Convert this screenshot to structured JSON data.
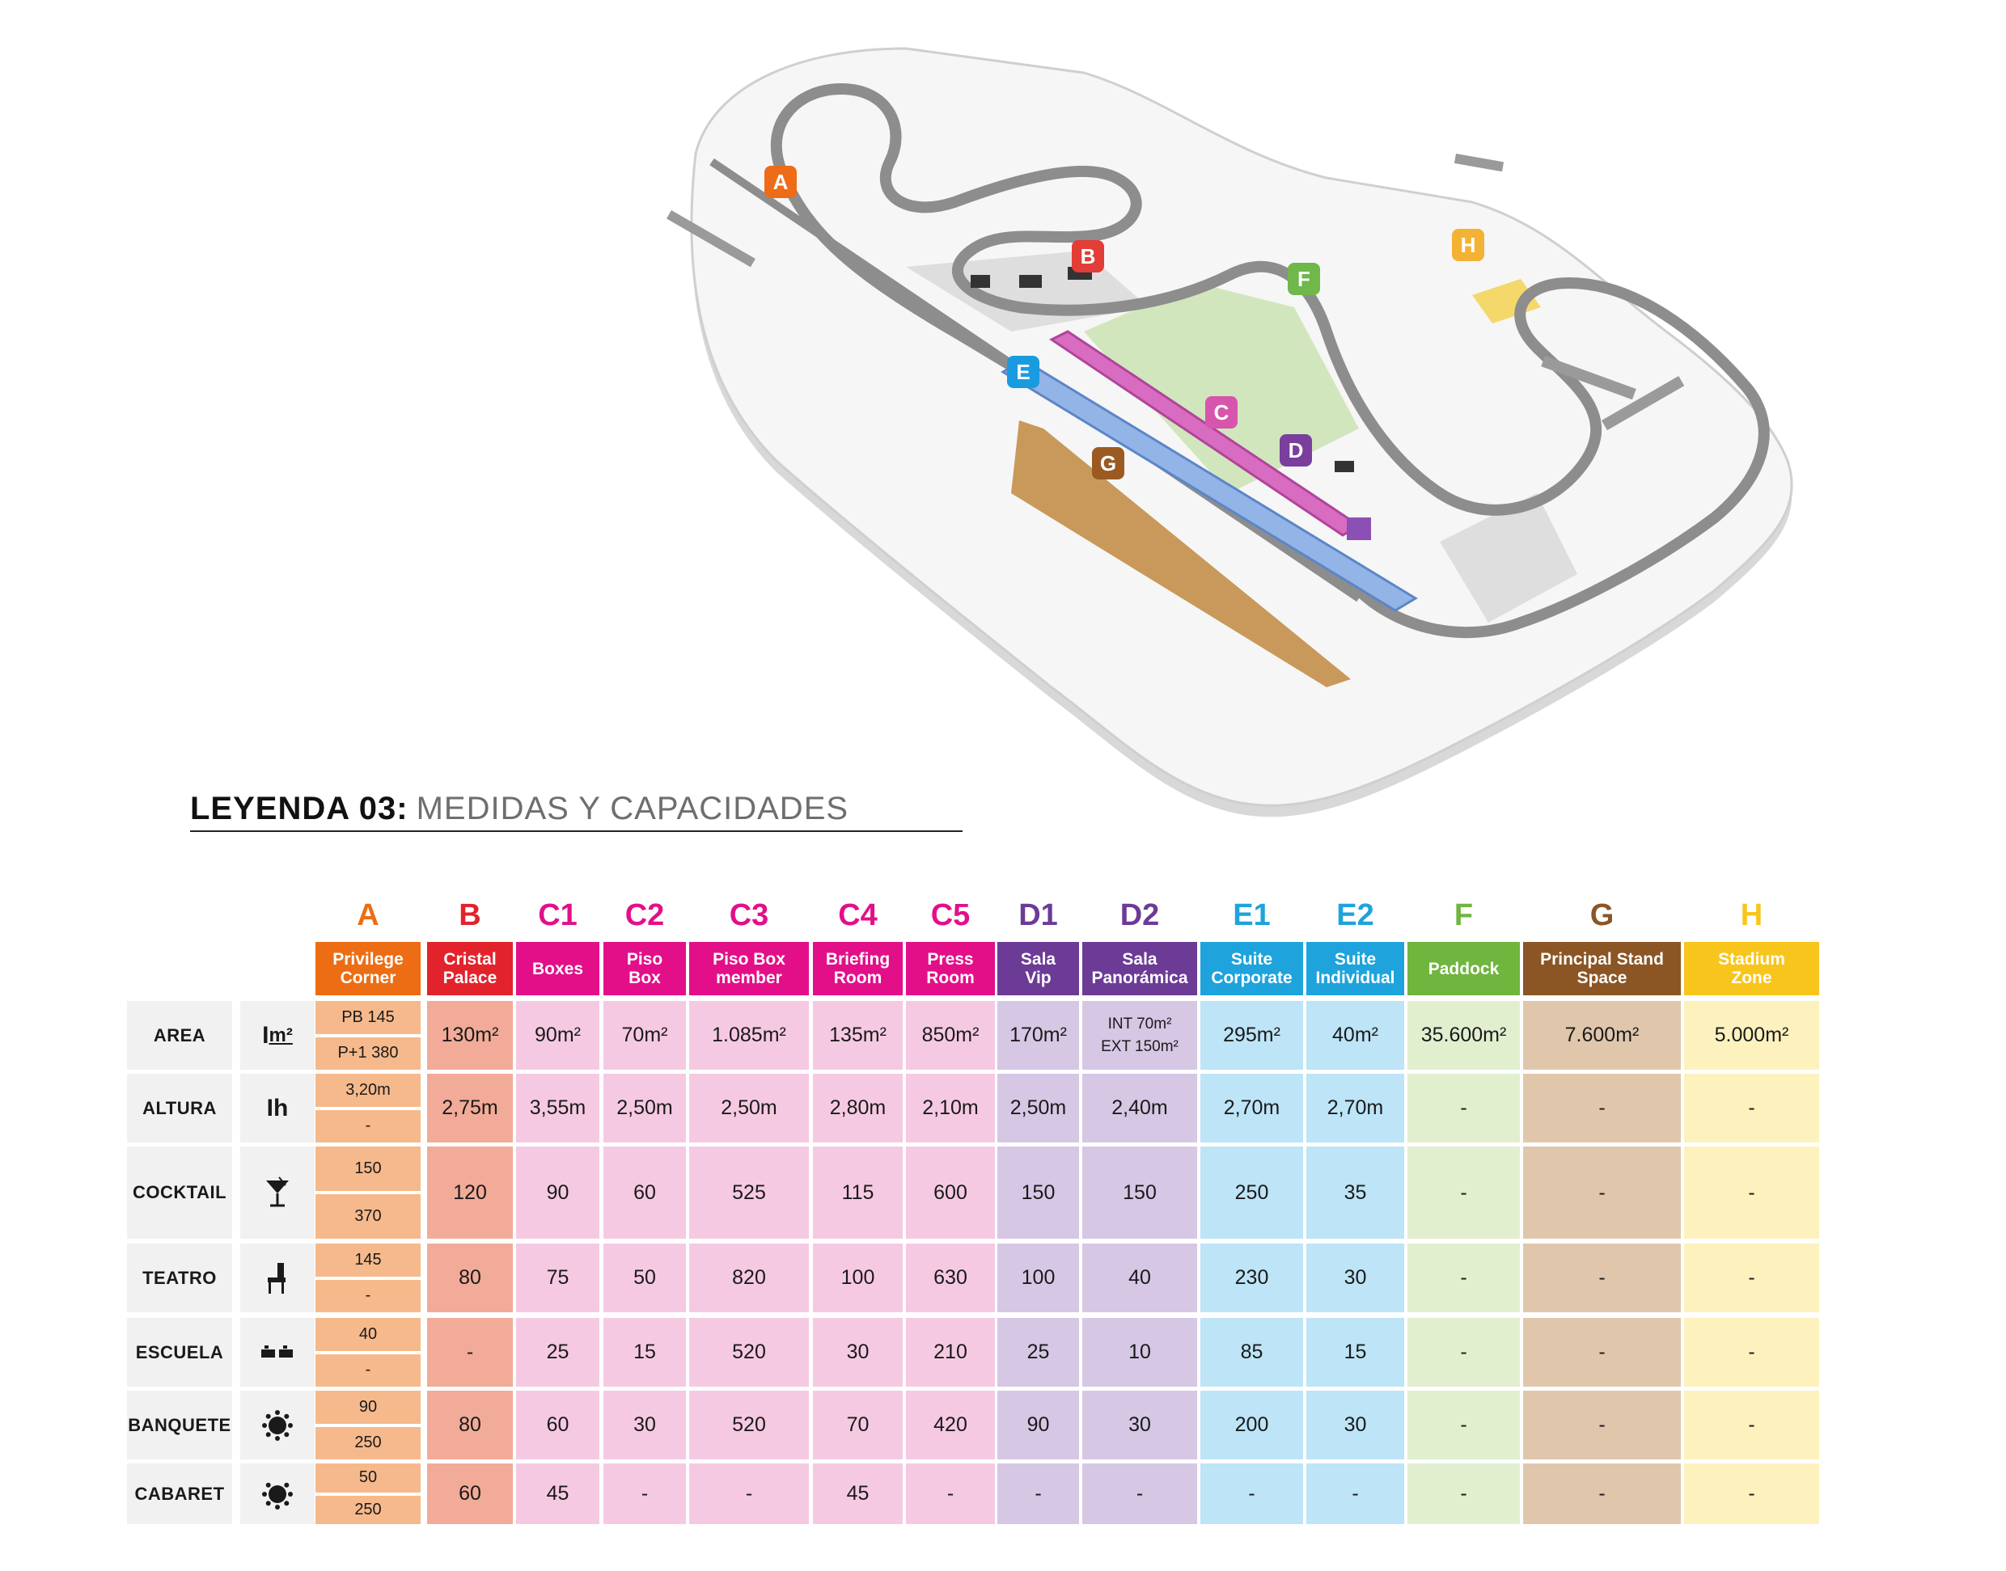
{
  "legend": {
    "title_bold": "LEYENDA 03:",
    "title_light": "MEDIDAS Y CAPACIDADES"
  },
  "map": {
    "markers": [
      {
        "label": "A",
        "color": "#ee6b18"
      },
      {
        "label": "B",
        "color": "#e23d36"
      },
      {
        "label": "C",
        "color": "#d755ad"
      },
      {
        "label": "D",
        "color": "#7a3e9d"
      },
      {
        "label": "E",
        "color": "#1a9be0"
      },
      {
        "label": "F",
        "color": "#6fb84a"
      },
      {
        "label": "G",
        "color": "#9a5a22"
      },
      {
        "label": "H",
        "color": "#f4b234"
      }
    ]
  },
  "table": {
    "columns": [
      {
        "letter": "A",
        "name_lines": [
          "Privilege",
          "Corner"
        ],
        "color": "#ec6d13",
        "fill": "#f6b98b"
      },
      {
        "letter": "B",
        "name_lines": [
          "Cristal",
          "Palace"
        ],
        "color": "#e2232c",
        "fill": "#f2ab98"
      },
      {
        "letter": "C1",
        "name_lines": [
          "Boxes"
        ],
        "color": "#e30f89",
        "fill": "#f6c9e2"
      },
      {
        "letter": "C2",
        "name_lines": [
          "Piso",
          "Box"
        ],
        "color": "#e30f89",
        "fill": "#f6c9e2"
      },
      {
        "letter": "C3",
        "name_lines": [
          "Piso Box",
          "member"
        ],
        "color": "#e30f89",
        "fill": "#f6c9e2"
      },
      {
        "letter": "C4",
        "name_lines": [
          "Briefing",
          "Room"
        ],
        "color": "#e30f89",
        "fill": "#f6c9e2"
      },
      {
        "letter": "C5",
        "name_lines": [
          "Press",
          "Room"
        ],
        "color": "#e30f89",
        "fill": "#f6c9e2"
      },
      {
        "letter": "D1",
        "name_lines": [
          "Sala",
          "Vip"
        ],
        "color": "#6c3b96",
        "fill": "#d6c7e5"
      },
      {
        "letter": "D2",
        "name_lines": [
          "Sala",
          "Panorámica"
        ],
        "color": "#6c3b96",
        "fill": "#d6c7e5"
      },
      {
        "letter": "E1",
        "name_lines": [
          "Suite",
          "Corporate"
        ],
        "color": "#1ea3dc",
        "fill": "#bde4f7"
      },
      {
        "letter": "E2",
        "name_lines": [
          "Suite",
          "Individual"
        ],
        "color": "#1ea3dc",
        "fill": "#bde4f7"
      },
      {
        "letter": "F",
        "name_lines": [
          "Paddock"
        ],
        "color": "#6fb53e",
        "fill": "#e1efcf"
      },
      {
        "letter": "G",
        "name_lines": [
          "Principal Stand",
          "Space"
        ],
        "color": "#8b5524",
        "fill": "#e0c7ac"
      },
      {
        "letter": "H",
        "name_lines": [
          "Stadium",
          "Zone"
        ],
        "color": "#f8c51d",
        "fill": "#fdf2be"
      }
    ],
    "rows": [
      {
        "label": "AREA",
        "icon": "area-icon",
        "icon_text": "m²",
        "a_top": "PB  145",
        "a_bottom": "P+1  380",
        "values": [
          "130m²",
          "90m²",
          "70m²",
          "1.085m²",
          "135m²",
          "850m²",
          "170m²",
          [
            "INT 70m²",
            "EXT 150m²"
          ],
          "295m²",
          "40m²",
          "35.600m²",
          "7.600m²",
          "5.000m²"
        ]
      },
      {
        "label": "ALTURA",
        "icon": "height-icon",
        "icon_text": "h",
        "a_top": "3,20m",
        "a_bottom": "-",
        "values": [
          "2,75m",
          "3,55m",
          "2,50m",
          "2,50m",
          "2,80m",
          "2,10m",
          "2,50m",
          "2,40m",
          "2,70m",
          "2,70m",
          "-",
          "-",
          "-"
        ]
      },
      {
        "label": "COCKTAIL",
        "icon": "cocktail-glass-icon",
        "a_top": "150",
        "a_bottom": "370",
        "values": [
          "120",
          "90",
          "60",
          "525",
          "115",
          "600",
          "150",
          "150",
          "250",
          "35",
          "-",
          "-",
          "-"
        ]
      },
      {
        "label": "TEATRO",
        "icon": "chair-icon",
        "a_top": "145",
        "a_bottom": "-",
        "values": [
          "80",
          "75",
          "50",
          "820",
          "100",
          "630",
          "100",
          "40",
          "230",
          "30",
          "-",
          "-",
          "-"
        ]
      },
      {
        "label": "ESCUELA",
        "icon": "school-desks-icon",
        "a_top": "40",
        "a_bottom": "-",
        "values": [
          "-",
          "25",
          "15",
          "520",
          "30",
          "210",
          "25",
          "10",
          "85",
          "15",
          "-",
          "-",
          "-"
        ]
      },
      {
        "label": "BANQUETE",
        "icon": "round-table-icon",
        "a_top": "90",
        "a_bottom": "250",
        "values": [
          "80",
          "60",
          "30",
          "520",
          "70",
          "420",
          "90",
          "30",
          "200",
          "30",
          "-",
          "-",
          "-"
        ]
      },
      {
        "label": "CABARET",
        "icon": "cabaret-table-icon",
        "a_top": "50",
        "a_bottom": "250",
        "values": [
          "60",
          "45",
          "-",
          "-",
          "45",
          "-",
          "-",
          "-",
          "-",
          "-",
          "-",
          "-",
          "-"
        ]
      }
    ]
  }
}
